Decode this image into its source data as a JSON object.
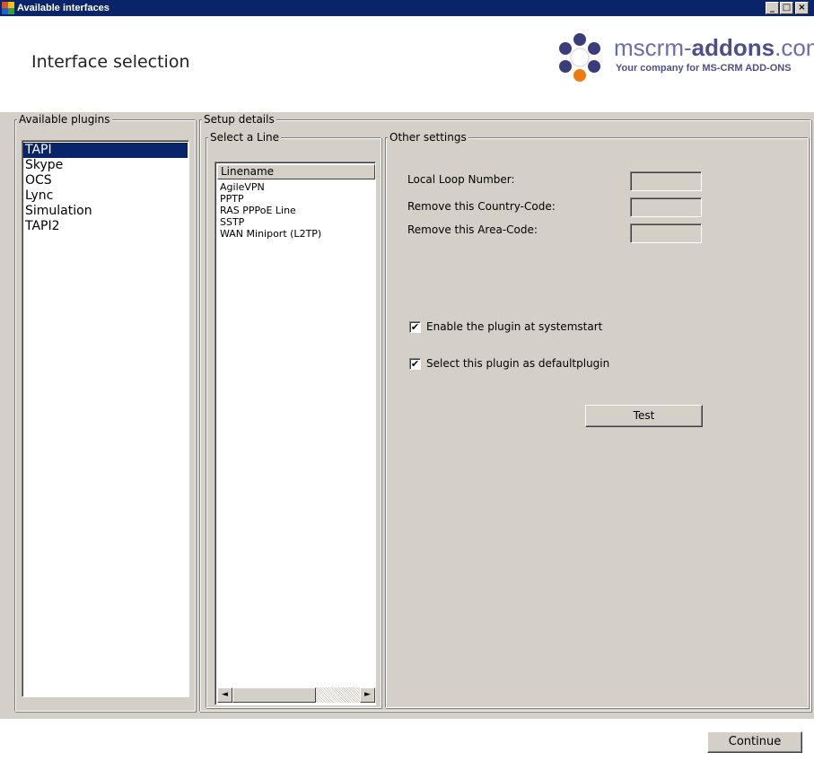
{
  "window": {
    "title": "Available interfaces",
    "minimize": "_",
    "maximize": "□",
    "close": "×"
  },
  "header": {
    "title": "Interface selection",
    "logo": {
      "name_prefix": "mscrm-",
      "name_bold": "addons",
      "name_suffix": ".com",
      "tagline": "Your company for MS-CRM ADD-ONS"
    }
  },
  "plugins": {
    "legend": "Available plugins",
    "items": [
      "TAPI",
      "Skype",
      "OCS",
      "Lync",
      "Simulation",
      "TAPI2"
    ],
    "selected": "TAPI"
  },
  "setup": {
    "legend": "Setup details",
    "select_line": {
      "legend": "Select a Line",
      "column_header": "Linename",
      "items": [
        "AgileVPN",
        "PPTP",
        "RAS PPPoE Line",
        "SSTP",
        "WAN Miniport (L2TP)"
      ],
      "scroll_left": "◄",
      "scroll_right": "►"
    },
    "other_settings": {
      "legend": "Other settings",
      "local_loop_label": "Local Loop Number:",
      "local_loop_value": "",
      "country_code_label": "Remove this Country-Code:",
      "country_code_value": "",
      "area_code_label": "Remove this Area-Code:",
      "area_code_value": "",
      "enable_label": "Enable the plugin at systemstart",
      "enable_checked": "✔",
      "default_label": "Select this plugin as defaultplugin",
      "default_checked": "✔",
      "test_label": "Test"
    }
  },
  "footer": {
    "continue_label": "Continue"
  },
  "colors": {
    "titlebar": "#0a246a",
    "dialog_gray": "#d4d0c8",
    "selection": "#0a246a",
    "logo_text": "#4d4f8c"
  }
}
